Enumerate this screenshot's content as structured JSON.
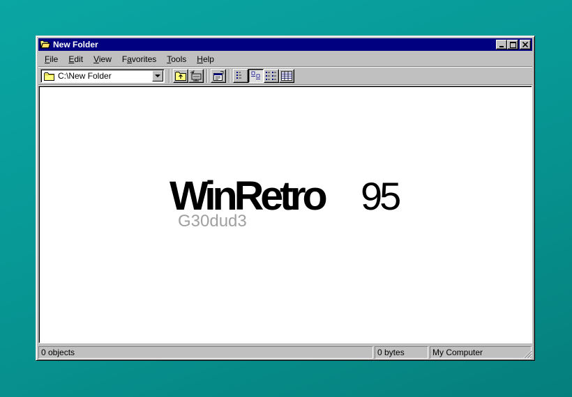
{
  "window": {
    "title": "New Folder",
    "title_icon": "folder-open-icon"
  },
  "menu": [
    {
      "label": "File",
      "accel": "F",
      "rest": "ile"
    },
    {
      "label": "Edit",
      "accel": "E",
      "rest": "dit"
    },
    {
      "label": "View",
      "accel": "V",
      "rest": "iew"
    },
    {
      "label": "Favorites",
      "accel": "a",
      "pre": "F",
      "rest": "vorites"
    },
    {
      "label": "Tools",
      "accel": "T",
      "rest": "ools"
    },
    {
      "label": "Help",
      "accel": "H",
      "rest": "elp"
    }
  ],
  "address": {
    "value": "C:\\New Folder",
    "icon": "folder-icon"
  },
  "toolbar": {
    "buttons": [
      "up-folder-icon",
      "map-drive-icon",
      "properties-icon",
      "large-icons-view-icon",
      "small-icons-view-icon",
      "list-view-icon",
      "details-view-icon"
    ]
  },
  "logo": {
    "main": "WinRetro",
    "number": "95",
    "sub": "G30dud3"
  },
  "status": {
    "objects": "0 objects",
    "bytes": "0 bytes",
    "location": "My Computer"
  },
  "colors": {
    "desktop": "#0a9e9c",
    "titlebar": "#000080",
    "face": "#c0c0c0"
  }
}
